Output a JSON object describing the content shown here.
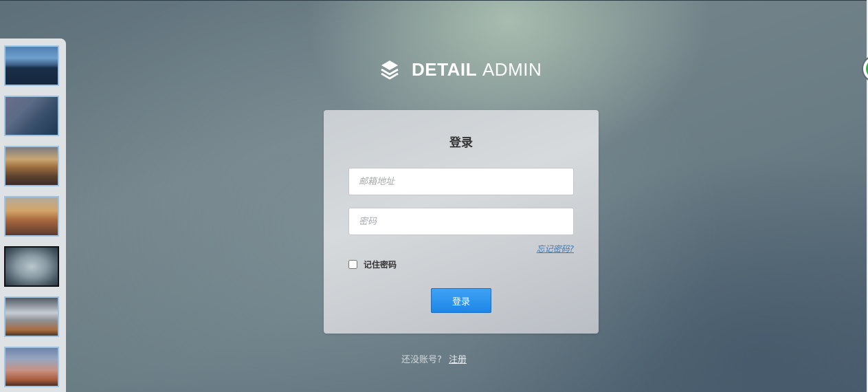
{
  "brand": {
    "bold": "DETAIL",
    "light": "ADMIN"
  },
  "thumbnails": [
    "bg-1",
    "bg-2",
    "bg-3",
    "bg-4",
    "bg-5",
    "bg-6",
    "bg-7"
  ],
  "login": {
    "title": "登录",
    "email_placeholder": "邮箱地址",
    "password_placeholder": "密码",
    "forgot_label": "忘记密码?",
    "remember_label": "记住密码",
    "submit_label": "登录"
  },
  "footer": {
    "prompt": "还没账号?",
    "register_label": "注册"
  }
}
